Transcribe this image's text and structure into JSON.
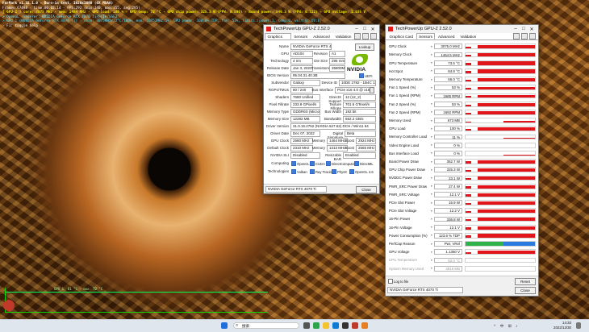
{
  "overlay": {
    "line1": "FurMark v1.32.1.0 - Burn-in test, 1920x1080 (0X MSAA)",
    "line2": "Frames:67498 - time:00:02:14 - FPS:292 (min:240, max:355, avg:295)",
    "line3": "[ GPU-Z ] core: 3075 MHz - mem: 1484 MHz - GPU load: 100 % - GPU temp: 72 °C - GPU chip power: 325.3 W (PPW: 0.890) - Board power: 349.3 W (PPW: 0.722) - GPU voltage: 1.035 V",
    "line4": "> OpenGL renderer: NVIDIA GeForce RTX 4070 Ti/PCIe/SSE2",
    "line5": "> GPU 1 (NVIDIA GeForce RTX 4070 Ti) - core: 3075MHz/72°C/100%, mem: 10752MHz/5%, GPU power: 100.0% TDP, fan: 53%, limits:[power:1, temp:0, volt:0, OV:0]",
    "line6": "- F1: toggle help",
    "graph_label": "GPU 1: 81 °C - max: 72 °C"
  },
  "gpuz_card": {
    "title": "TechPowerUp GPU-Z 2.52.0",
    "tabs": [
      "Graphics Card",
      "Sensors",
      "Advanced",
      "Validation"
    ],
    "lookup_label": "Lookup",
    "brand_word": "NVIDIA",
    "fields": {
      "name": "NVIDIA GeForce RTX 4070 Ti",
      "gpu": "AD104",
      "revision": "A1",
      "technology": "4 nm",
      "die_size": "295 mm²",
      "release_date": "Jan 3, 2023",
      "transistors": "35800M",
      "bios": "95.04.31.40.3B",
      "subvendor": "Galaxy",
      "device_id": "10DE 2782 - 1B4C 139E",
      "rops": "80 / 240",
      "bus_interface": "PCIe x16 4.0 @ x16 4.0",
      "shaders": "7680 Unified",
      "directx": "12 (12_2)",
      "pixel_fillrate": "233.9 GPixel/s",
      "texture_fillrate": "701.6 GTexel/s",
      "memory_type": "GDDR6X (Micron)",
      "bus_width": "192 bit",
      "memory_size": "12282 MB",
      "bandwidth": "562.2 GB/s",
      "driver_version": "31.0.15.2752 (NVIDIA 527.62) DCH / Win11 64",
      "driver_date": "Dec 07, 2022",
      "digital_signature": "Beta",
      "gpu_clock": "2580 MHz",
      "gpu_memory": "1464 MHz",
      "gpu_boost": "2924 MHz",
      "default_clock": "2310 MHz",
      "default_memory": "1313 MHz",
      "default_boost": "2565 MHz",
      "nvidia_sli": "Disabled",
      "resizable_bar": "Enabled"
    },
    "labels": {
      "name": "Name",
      "gpu": "GPU",
      "revision": "Revision",
      "technology": "Technology",
      "die_size": "Die Size",
      "release_date": "Release Date",
      "transistors": "Transistors",
      "bios": "BIOS Version",
      "uefi": "UEFI",
      "subvendor": "Subvendor",
      "device_id": "Device ID",
      "rops": "ROPs/TMUs",
      "bus_interface": "Bus Interface",
      "shaders": "Shaders",
      "directx": "DirectX Support",
      "pixel_fillrate": "Pixel Fillrate",
      "texture_fillrate": "Texture Fillrate",
      "memory_type": "Memory Type",
      "bus_width": "Bus Width",
      "memory_size": "Memory Size",
      "bandwidth": "Bandwidth",
      "driver_version": "Driver Version",
      "driver_date": "Driver Date",
      "digital_signature": "Digital Signature",
      "gpu_clock": "GPU Clock",
      "memory": "Memory",
      "boost": "Boost",
      "default_clock": "Default Clock",
      "nvidia_sli": "NVIDIA SLI",
      "resizable_bar": "Resizable BAR",
      "computing": "Computing",
      "technologies": "Technologies"
    },
    "computing": [
      "OpenCL",
      "CUDA",
      "DirectCompute",
      "DirectML"
    ],
    "technologies": [
      "Vulkan",
      "Ray Tracing",
      "PhysX",
      "OpenGL 4.6"
    ],
    "selected_card": "NVIDIA GeForce RTX 4070 Ti",
    "close_label": "Close"
  },
  "gpuz_sensors": {
    "title": "TechPowerUp GPU-Z 2.52.0",
    "tabs": [
      "Graphics Card",
      "Sensors",
      "Advanced",
      "Validation"
    ],
    "sensors": [
      {
        "name": "GPU Clock",
        "value": "3075.0 MHz",
        "level": 0.92
      },
      {
        "name": "Memory Clock",
        "value": "1464.5 MHz",
        "level": 0.92
      },
      {
        "name": "GPU Temperature",
        "value": "73.5 °C",
        "level": 0.9
      },
      {
        "name": "Hot Spot",
        "value": "84.8 °C",
        "level": 0.9
      },
      {
        "name": "Memory Temperature",
        "value": "56.0 °C",
        "level": 0.75
      },
      {
        "name": "Fan 1 Speed (%)",
        "value": "53 %",
        "level": 0.7
      },
      {
        "name": "Fan 1 Speed (RPM)",
        "value": "1685 RPM",
        "level": 0.7
      },
      {
        "name": "Fan 2 Speed (%)",
        "value": "53 %",
        "level": 0.7
      },
      {
        "name": "Fan 2 Speed (RPM)",
        "value": "1692 RPM",
        "level": 0.7
      },
      {
        "name": "Memory Used",
        "value": "673 MB",
        "level": 0.4
      },
      {
        "name": "GPU Load",
        "value": "100 %",
        "level": 0.9
      },
      {
        "name": "Memory Controller Load",
        "value": "11 %",
        "level": 0.3
      },
      {
        "name": "Video Engine Load",
        "value": "0 %",
        "level": 0.0
      },
      {
        "name": "Bus Interface Load",
        "value": "0 %",
        "level": 0.1
      },
      {
        "name": "Board Power Draw",
        "value": "352.7 W",
        "level": 0.9
      },
      {
        "name": "GPU Chip Power Draw",
        "value": "325.3 W",
        "level": 0.9
      },
      {
        "name": "NVDDC Power Draw",
        "value": "23.1 W",
        "level": 0.85
      },
      {
        "name": "PWR_SRC Power Draw",
        "value": "27.4 W",
        "level": 0.85
      },
      {
        "name": "PWR_SRC Voltage",
        "value": "12.1 V",
        "level": 0.85
      },
      {
        "name": "PCIe Slot Power",
        "value": "15.9 W",
        "level": 0.8
      },
      {
        "name": "PCIe Slot Voltage",
        "value": "12.2 V",
        "level": 0.85
      },
      {
        "name": "16-Pin Power",
        "value": "336.8 W",
        "level": 0.9
      },
      {
        "name": "16-Pin Voltage",
        "value": "12.1 V",
        "level": 0.85
      },
      {
        "name": "Power Consumption (%)",
        "value": "123.6 % TDP",
        "level": 0.9
      },
      {
        "name": "PerfCap Reason",
        "value": "Pwr, VRel",
        "level": 0.9,
        "perfcap": true
      },
      {
        "name": "GPU Voltage",
        "value": "1.1350 V",
        "level": 0.9
      },
      {
        "name": "CPU Temperature",
        "value": "62.0 °C",
        "level": 0.0
      },
      {
        "name": "System Memory Used",
        "value": "4818 MB",
        "level": 0.0
      }
    ],
    "log_label": "Log to file",
    "reset_label": "Reset",
    "selected_card": "NVIDIA GeForce RTX 4070 Ti",
    "close_label": "Close"
  },
  "taskbar": {
    "search_placeholder": "搜索",
    "time": "14:33",
    "date": "2022/12/30",
    "sys_icons": "^ 中 ⊞ ♪"
  },
  "colors": {
    "graph": "#e2151b",
    "perfcap_green": "#2db34a",
    "perfcap_blue": "#2a7be0",
    "nvidia_green": "#76b900"
  }
}
